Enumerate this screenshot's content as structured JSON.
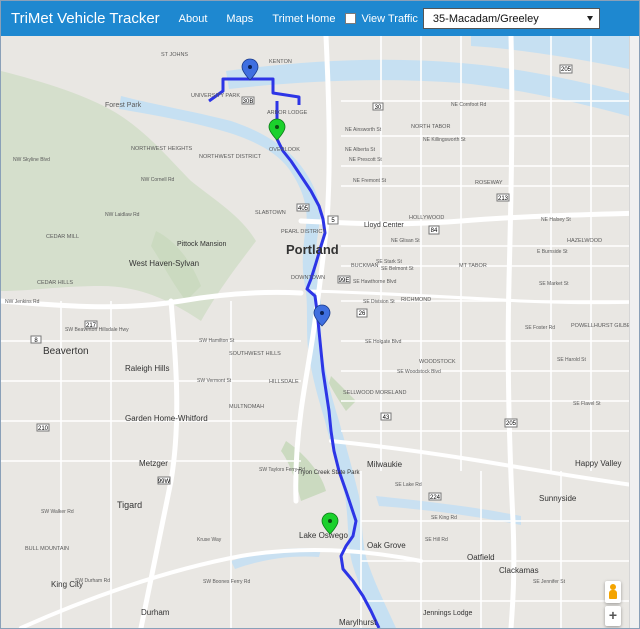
{
  "navbar": {
    "brand": "TriMet Vehicle Tracker",
    "links": [
      "About",
      "Maps",
      "Trimet Home"
    ],
    "traffic_label": "View Traffic",
    "traffic_checked": false,
    "route_selected": "35-Macadam/Greeley"
  },
  "map": {
    "cities": [
      {
        "id": "portland",
        "name": "Portland"
      },
      {
        "id": "beaverton",
        "name": "Beaverton"
      },
      {
        "id": "west-haven",
        "name": "West Haven-Sylvan"
      },
      {
        "id": "raleigh",
        "name": "Raleigh Hills"
      },
      {
        "id": "garden-home",
        "name": "Garden Home-Whitford"
      },
      {
        "id": "metzger",
        "name": "Metzger"
      },
      {
        "id": "tigard",
        "name": "Tigard"
      },
      {
        "id": "king-city",
        "name": "King City"
      },
      {
        "id": "durham",
        "name": "Durham"
      },
      {
        "id": "lake-oswego",
        "name": "Lake Oswego"
      },
      {
        "id": "milwaukie",
        "name": "Milwaukie"
      },
      {
        "id": "oak-grove",
        "name": "Oak Grove"
      },
      {
        "id": "oatfield",
        "name": "Oatfield"
      },
      {
        "id": "clackamas",
        "name": "Clackamas"
      },
      {
        "id": "sunnyside",
        "name": "Sunnyside"
      },
      {
        "id": "happy-valley",
        "name": "Happy Valley"
      },
      {
        "id": "marylhurst",
        "name": "Marylhurst"
      },
      {
        "id": "jennings",
        "name": "Jennings Lodge"
      },
      {
        "id": "pittock",
        "name": "Pittock Mansion"
      },
      {
        "id": "tryon",
        "name": "Tryon Creek State Park"
      },
      {
        "id": "garden-center",
        "name": "Lloyd Center"
      }
    ],
    "neighborhoods": [
      "ST JOHNS",
      "KENTON",
      "UNIVERSITY PARK",
      "ARBOR LODGE",
      "OVERLOOK",
      "NORTH TABOR",
      "NORTHWEST HEIGHTS",
      "NORTHWEST DISTRICT",
      "SLABTOWN",
      "PEARL DISTRICT",
      "DOWNTOWN",
      "HOLLYWOOD",
      "ROSEWAY",
      "HAZELWOOD",
      "BUCKMAN",
      "MT TABOR",
      "RICHMOND",
      "SOUTHWEST HILLS",
      "HILLSDALE",
      "MULTNOMAH",
      "WOODSTOCK",
      "SELLWOOD MORELAND",
      "POWELLHURST GILBERT",
      "CEDAR MILL",
      "CEDAR HILLS",
      "BULL MOUNTAIN",
      "Forest Park"
    ],
    "streets": [
      "NE Ainsworth St",
      "NE Killingsworth St",
      "NE Alberta St",
      "NE Prescott St",
      "NE Fremont St",
      "NE Cornfoot Rd",
      "NE Halsey St",
      "NE Glisan St",
      "E Burnside St",
      "SE Stark St",
      "SE Belmont St",
      "SE Hawthorne Blvd",
      "SE Division St",
      "SE Holgate Blvd",
      "SE Harold St",
      "SE Woodstock Blvd",
      "SE Flavel St",
      "SE Foster Rd",
      "SE Market St",
      "SE King Rd",
      "SE Hill Rd",
      "SE Jennifer St",
      "SW Hamilton St",
      "SW Vermont St",
      "SW Beaverton Hillsdale Hwy",
      "SW Durham Rd",
      "NW Cornell Rd",
      "NW Laidlaw Rd",
      "NW Skyline Blvd",
      "NW Jenkins Rd",
      "SW Walker Rd",
      "Kruse Way",
      "SW Boones Ferry Rd",
      "SW Taylors Ferry Rd",
      "SE Lake Rd"
    ],
    "highway_shields": [
      "5",
      "84",
      "205",
      "405",
      "26",
      "99E",
      "99W",
      "217",
      "30B",
      "30",
      "224",
      "213",
      "210",
      "43",
      "8"
    ],
    "markers": [
      {
        "id": "bus-1",
        "kind": "bus",
        "color": "#3f6fe0"
      },
      {
        "id": "stop-1",
        "kind": "stop",
        "color": "#1bd12c"
      },
      {
        "id": "bus-2",
        "kind": "bus",
        "color": "#3f6fe0"
      },
      {
        "id": "stop-2",
        "kind": "stop",
        "color": "#1bd12c"
      }
    ],
    "route_color": "#2d35e6"
  },
  "controls": {
    "zoom_in_label": "+"
  }
}
